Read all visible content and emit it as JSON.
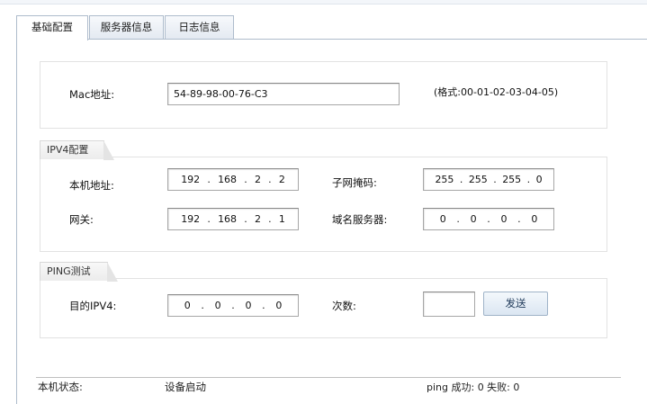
{
  "tabs": [
    {
      "label": "基础配置",
      "active": true
    },
    {
      "label": "服务器信息",
      "active": false
    },
    {
      "label": "日志信息",
      "active": false
    }
  ],
  "mac": {
    "label": "Mac地址:",
    "value": "54-89-98-00-76-C3",
    "format_hint": "(格式:00-01-02-03-04-05)"
  },
  "ipv4": {
    "legend": "IPV4配置",
    "local_label": "本机地址:",
    "local": [
      "192",
      "168",
      "2",
      "2"
    ],
    "mask_label": "子网掩码:",
    "mask": [
      "255",
      "255",
      "255",
      "0"
    ],
    "gateway_label": "网关:",
    "gateway": [
      "192",
      "168",
      "2",
      "1"
    ],
    "dns_label": "域名服务器:",
    "dns": [
      "0",
      "0",
      "0",
      "0"
    ]
  },
  "ping": {
    "legend": "PING测试",
    "target_label": "目的IPV4:",
    "target": [
      "0",
      "0",
      "0",
      "0"
    ],
    "count_label": "次数:",
    "count_value": "",
    "send_label": "发送"
  },
  "status": {
    "label": "本机状态:",
    "value": "设备启动",
    "ping_result": "ping 成功: 0 失败: 0"
  }
}
